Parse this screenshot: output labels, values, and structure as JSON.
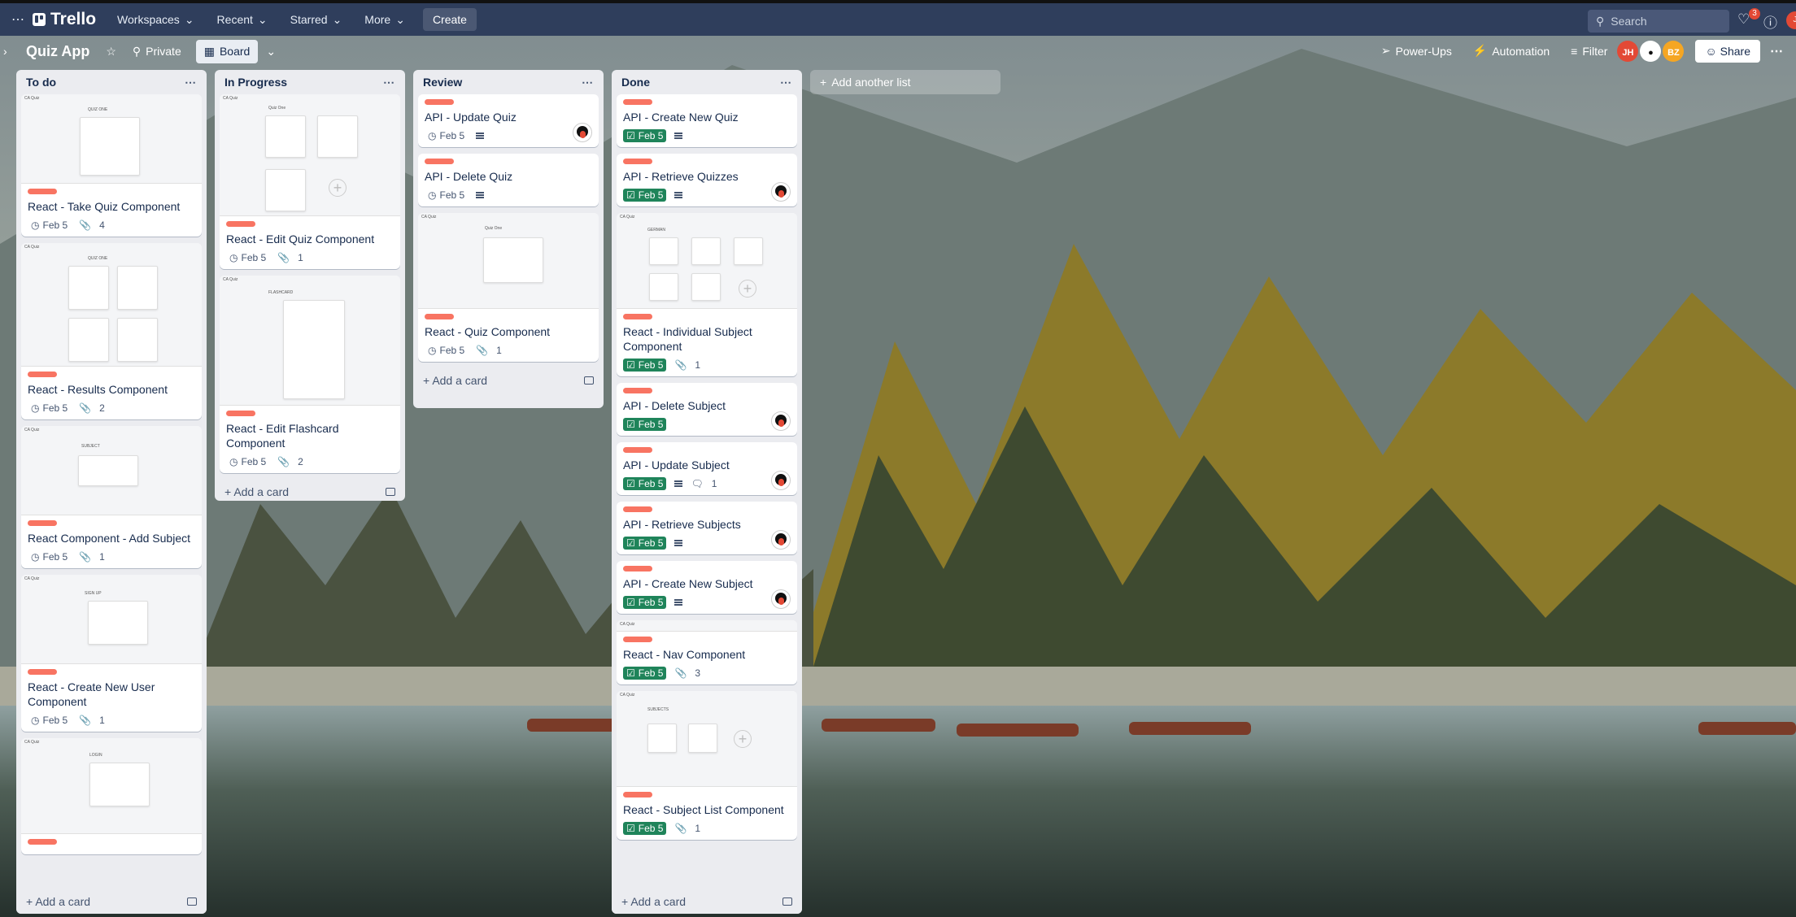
{
  "topbar": {
    "app_name": "Trello",
    "menus": [
      "Workspaces",
      "Recent",
      "Starred",
      "More"
    ],
    "create_label": "Create",
    "search_placeholder": "Search",
    "notification_count": "3"
  },
  "board": {
    "title": "Quiz App",
    "visibility_label": "Private",
    "view_label": "Board",
    "powerups_label": "Power-Ups",
    "automation_label": "Automation",
    "filter_label": "Filter",
    "members": [
      {
        "initials": "JH",
        "color": "#e34935"
      },
      {
        "initials": "",
        "color": "#ffffff"
      },
      {
        "initials": "BZ",
        "color": "#f5a623"
      }
    ],
    "share_label": "Share",
    "add_list_label": "Add another list"
  },
  "colors": {
    "label_red": "#f87462",
    "due_green": "#1f845a",
    "topbar": "#2f3e5c"
  },
  "lists": [
    {
      "title": "To do",
      "add_card_label": "Add a card",
      "cards": [
        {
          "title": "React - Take Quiz Component",
          "due": "Feb 5",
          "attachments": "4",
          "cover": "QUIZ ONE"
        },
        {
          "title": "React - Results Component",
          "due": "Feb 5",
          "attachments": "2",
          "cover": "QUIZ ONE"
        },
        {
          "title": "React Component - Add Subject",
          "due": "Feb 5",
          "attachments": "1",
          "cover": "SUBJECT"
        },
        {
          "title": "React - Create New User Component",
          "due": "Feb 5",
          "attachments": "1",
          "cover": "SIGN UP"
        },
        {
          "title": "",
          "cover": "LOGIN"
        }
      ]
    },
    {
      "title": "In Progress",
      "add_card_label": "Add a card",
      "cards": [
        {
          "title": "React - Edit Quiz Component",
          "due": "Feb 5",
          "attachments": "1",
          "cover": "Quiz One"
        },
        {
          "title": "React - Edit Flashcard Component",
          "due": "Feb 5",
          "attachments": "2",
          "cover": "FLASHCARD"
        }
      ]
    },
    {
      "title": "Review",
      "add_card_label": "Add a card",
      "cards": [
        {
          "title": "API - Update Quiz",
          "due": "Feb 5"
        },
        {
          "title": "API - Delete Quiz",
          "due": "Feb 5"
        },
        {
          "title": "React - Quiz Component",
          "due": "Feb 5",
          "attachments": "1",
          "cover": "Quiz One"
        }
      ]
    },
    {
      "title": "Done",
      "add_card_label": "Add a card",
      "cards": [
        {
          "title": "API - Create New Quiz",
          "due": "Feb 5"
        },
        {
          "title": "API - Retrieve Quizzes",
          "due": "Feb 5"
        },
        {
          "title": "React - Individual Subject Component",
          "due": "Feb 5",
          "attachments": "1",
          "cover": "GERMAN"
        },
        {
          "title": "API - Delete Subject",
          "due": "Feb 5"
        },
        {
          "title": "API - Update Subject",
          "due": "Feb 5",
          "comments": "1"
        },
        {
          "title": "API - Retrieve Subjects",
          "due": "Feb 5"
        },
        {
          "title": "API - Create New Subject",
          "due": "Feb 5"
        },
        {
          "title": "React - Nav Component",
          "due": "Feb 5",
          "attachments": "3"
        },
        {
          "title": "React - Subject List Component",
          "due": "Feb 5",
          "attachments": "1",
          "cover": "SUBJECTS"
        }
      ]
    }
  ]
}
